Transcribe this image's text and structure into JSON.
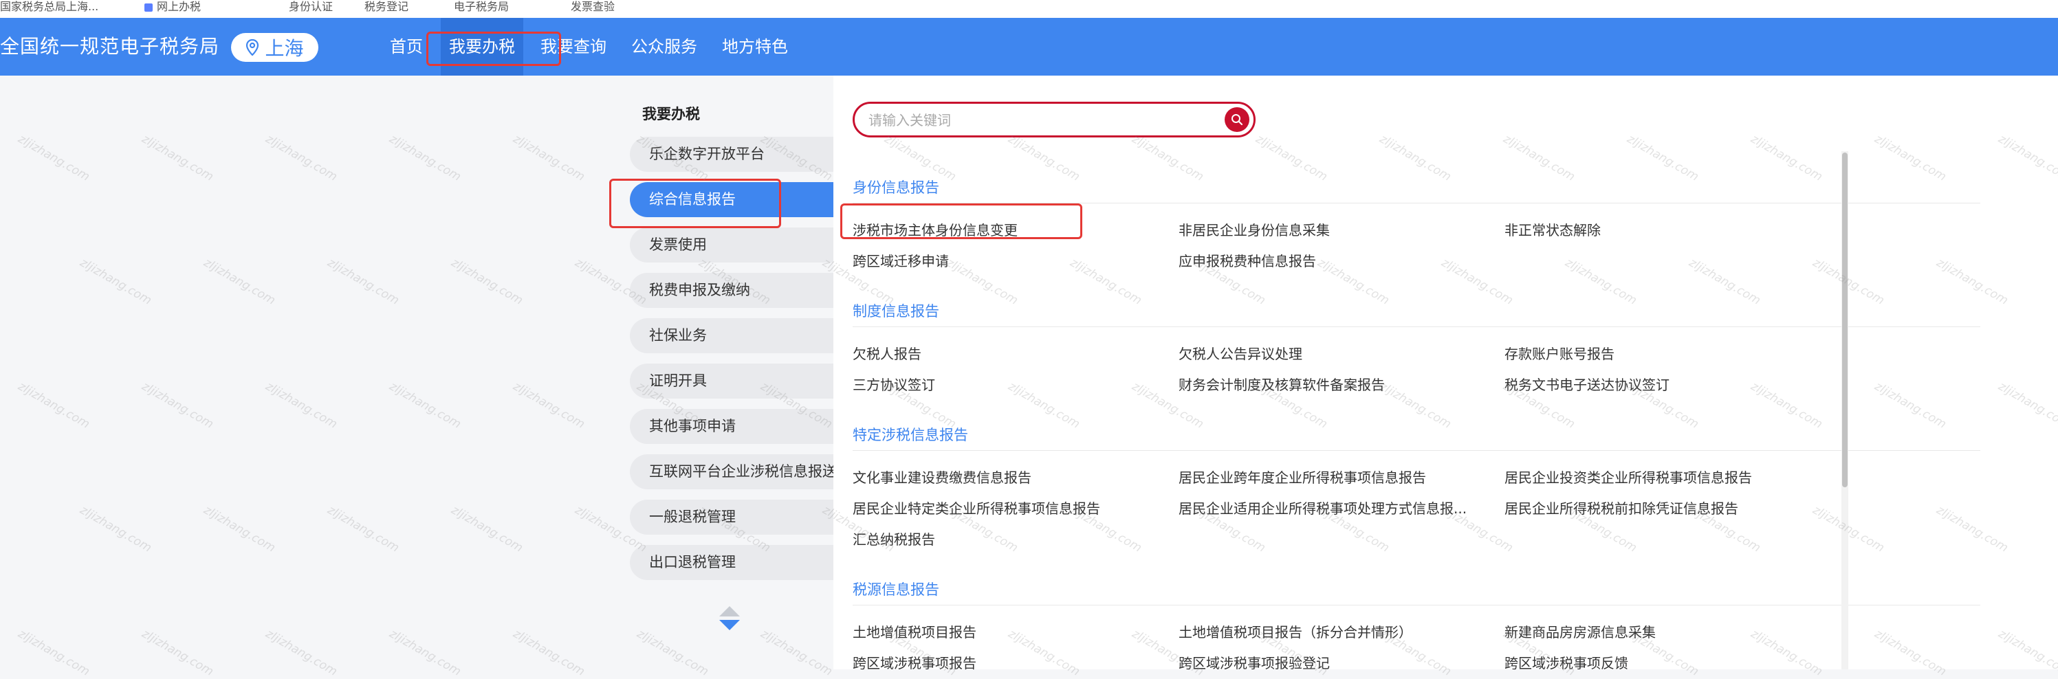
{
  "bookmarks": [
    "国家税务总局上海...",
    "网上办税",
    "身份认证",
    "税务登记",
    "电子税务局",
    "发票查验"
  ],
  "header": {
    "site_title": "全国统一规范电子税务局",
    "city": "上海",
    "nav": [
      {
        "label": "首页"
      },
      {
        "label": "我要办税"
      },
      {
        "label": "我要查询"
      },
      {
        "label": "公众服务"
      },
      {
        "label": "地方特色"
      }
    ]
  },
  "menu": {
    "title": "我要办税",
    "items": [
      "乐企数字开放平台",
      "综合信息报告",
      "发票使用",
      "税费申报及缴纳",
      "社保业务",
      "证明开具",
      "其他事项申请",
      "互联网平台企业涉税信息报送",
      "一般退税管理",
      "出口退税管理"
    ],
    "selected_index": 1
  },
  "search": {
    "placeholder": "请输入关键词",
    "value": ""
  },
  "sections": [
    {
      "title": "身份信息报告",
      "links": [
        [
          "涉税市场主体身份信息变更",
          "非居民企业身份信息采集",
          "非正常状态解除"
        ],
        [
          "跨区域迁移申请",
          "应申报税费种信息报告"
        ]
      ]
    },
    {
      "title": "制度信息报告",
      "links": [
        [
          "欠税人报告",
          "欠税人公告异议处理",
          "存款账户账号报告"
        ],
        [
          "三方协议签订",
          "财务会计制度及核算软件备案报告",
          "税务文书电子送达协议签订"
        ]
      ]
    },
    {
      "title": "特定涉税信息报告",
      "links": [
        [
          "文化事业建设费缴费信息报告",
          "居民企业跨年度企业所得税事项信息报告",
          "居民企业投资类企业所得税事项信息报告"
        ],
        [
          "居民企业特定类企业所得税事项信息报告",
          "居民企业适用企业所得税事项处理方式信息报...",
          "居民企业所得税税前扣除凭证信息报告"
        ],
        [
          "汇总纳税报告"
        ]
      ]
    },
    {
      "title": "税源信息报告",
      "links": [
        [
          "土地增值税项目报告",
          "土地增值税项目报告（拆分合并情形）",
          "新建商品房房源信息采集"
        ],
        [
          "跨区域涉税事项报告",
          "跨区域涉税事项报验登记",
          "跨区域涉税事项反馈"
        ]
      ]
    }
  ],
  "watermark": "zljizhang.com",
  "colors": {
    "header_blue": "#3f86ef",
    "search_red": "#c8102e",
    "highlight_red": "#e53935"
  }
}
